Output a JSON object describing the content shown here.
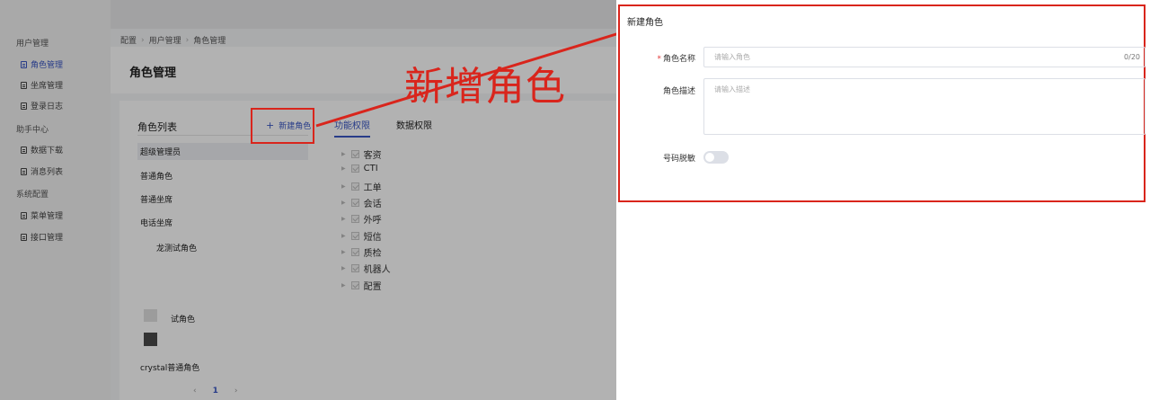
{
  "sidebar": {
    "groups": [
      {
        "label": "用户管理"
      },
      {
        "label": "助手中心"
      },
      {
        "label": "系统配置"
      }
    ],
    "items": [
      {
        "label": "角色管理",
        "active": true
      },
      {
        "label": "坐席管理"
      },
      {
        "label": "登录日志"
      },
      {
        "label": "数据下载"
      },
      {
        "label": "消息列表"
      },
      {
        "label": "菜单管理"
      },
      {
        "label": "接口管理"
      }
    ]
  },
  "breadcrumb": [
    "配置",
    "用户管理",
    "角色管理"
  ],
  "page": {
    "title": "角色管理"
  },
  "role_list": {
    "title": "角色列表",
    "add_label": "新建角色",
    "roles": [
      "超级管理员",
      "普通角色",
      "普通坐席",
      "电话坐席",
      "龙测试角色",
      "试角色",
      "crystal普通角色"
    ]
  },
  "pagination": {
    "prev": "‹",
    "current": "1",
    "next": "›"
  },
  "tabs": [
    {
      "label": "功能权限",
      "active": true
    },
    {
      "label": "数据权限"
    }
  ],
  "permissions": [
    "客资",
    "CTI",
    "工单",
    "会话",
    "外呼",
    "短信",
    "质检",
    "机器人",
    "配置"
  ],
  "annotation": {
    "text": "新增角色",
    "color": "#d9251c"
  },
  "drawer": {
    "title": "新建角色",
    "name_label": "角色名称",
    "name_placeholder": "请输入角色",
    "name_counter": "0/20",
    "desc_label": "角色描述",
    "desc_placeholder": "请输入描述",
    "mask_label": "号码脱敏",
    "mask_enabled": false
  },
  "colors": {
    "accent": "#3a57c4",
    "highlight": "#d9251c"
  }
}
